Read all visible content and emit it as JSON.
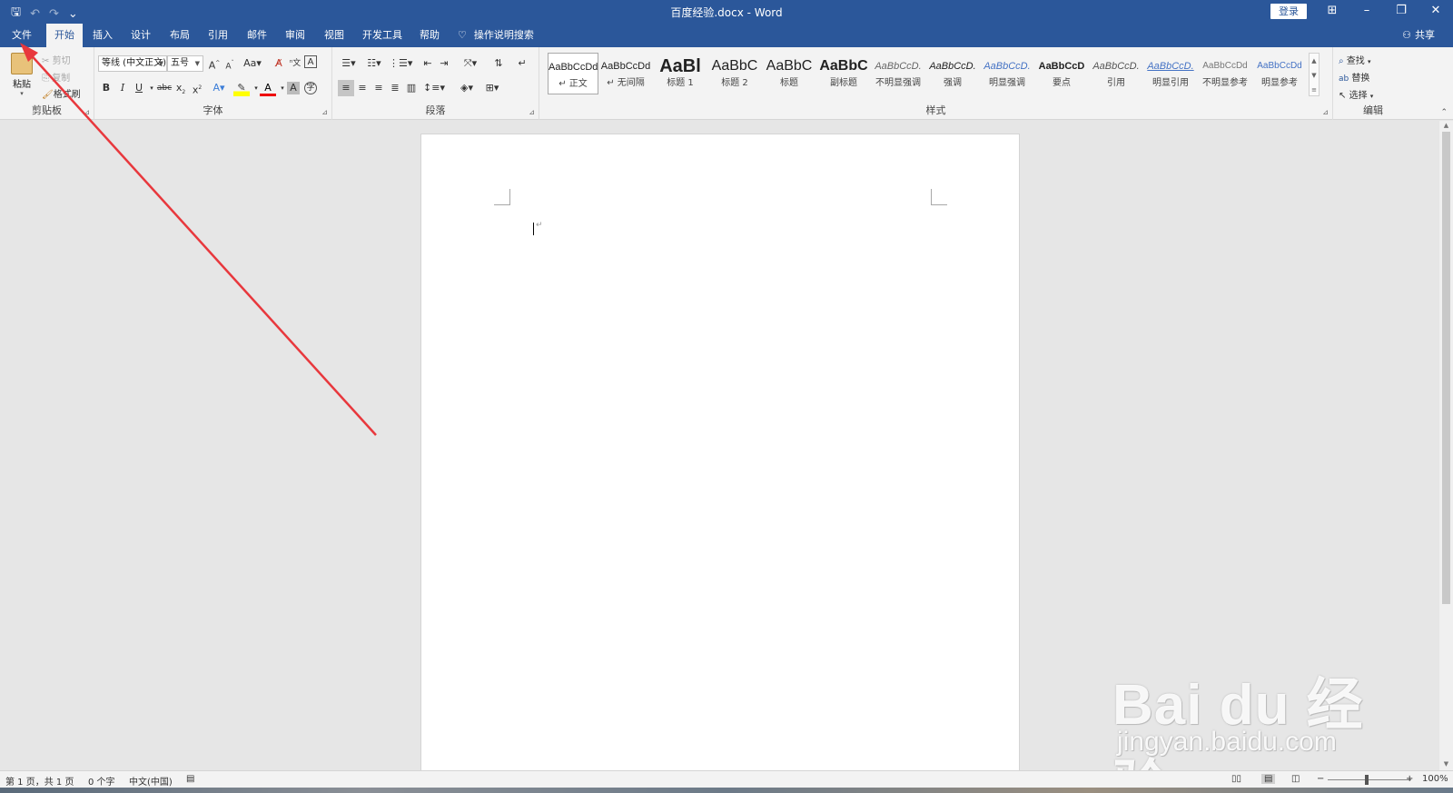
{
  "window": {
    "title": "百度经验.docx  -  Word",
    "login": "登录",
    "controls": {
      "ribbon_options": "⊞",
      "minimize": "–",
      "restore": "❐",
      "close": "✕"
    }
  },
  "qat": {
    "save": "🖫",
    "undo": "↶",
    "redo": "↷",
    "customize": "⌄"
  },
  "tabs": [
    {
      "label": "文件"
    },
    {
      "label": "开始"
    },
    {
      "label": "插入"
    },
    {
      "label": "设计"
    },
    {
      "label": "布局"
    },
    {
      "label": "引用"
    },
    {
      "label": "邮件"
    },
    {
      "label": "审阅"
    },
    {
      "label": "视图"
    },
    {
      "label": "开发工具"
    },
    {
      "label": "帮助"
    }
  ],
  "tellme": {
    "label": "操作说明搜索"
  },
  "share": {
    "label": "共享"
  },
  "clipboard": {
    "paste": "粘贴",
    "cut": "剪切",
    "copy": "复制",
    "format_painter": "格式刷",
    "group": "剪贴板"
  },
  "font": {
    "name": "等线 (中文正文)",
    "size": "五号",
    "group": "字体"
  },
  "paragraph": {
    "group": "段落"
  },
  "styles": {
    "group": "样式",
    "items": [
      {
        "sample": "AaBbCcDd",
        "name": "↵ 正文"
      },
      {
        "sample": "AaBbCcDd",
        "name": "↵ 无间隔"
      },
      {
        "sample": "AaBl",
        "name": "标题 1"
      },
      {
        "sample": "AaBbC",
        "name": "标题 2"
      },
      {
        "sample": "AaBbC",
        "name": "标题"
      },
      {
        "sample": "AaBbC",
        "name": "副标题"
      },
      {
        "sample": "AaBbCcD.",
        "name": "不明显强调"
      },
      {
        "sample": "AaBbCcD.",
        "name": "强调"
      },
      {
        "sample": "AaBbCcD.",
        "name": "明显强调"
      },
      {
        "sample": "AaBbCcD",
        "name": "要点"
      },
      {
        "sample": "AaBbCcD.",
        "name": "引用"
      },
      {
        "sample": "AaBbCcD.",
        "name": "明显引用"
      },
      {
        "sample": "AaBbCcDd",
        "name": "不明显参考"
      },
      {
        "sample": "AaBbCcDd",
        "name": "明显参考"
      }
    ]
  },
  "editing": {
    "find": "查找",
    "replace": "替换",
    "select": "选择",
    "group": "编辑"
  },
  "status": {
    "page": "第 1 页，共 1 页",
    "words": "0 个字",
    "lang": "中文(中国)",
    "zoom": "100%"
  },
  "watermark": {
    "main": "Bai du 经验",
    "sub": "jingyan.baidu.com"
  }
}
